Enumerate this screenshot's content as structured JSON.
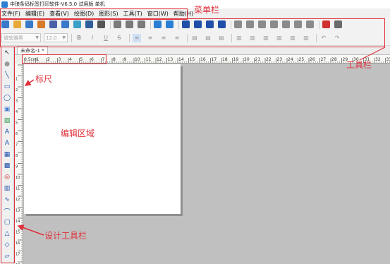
{
  "window": {
    "title": "中琅条码标签打印软件-V6.5.0 试用版 单机"
  },
  "menubar": {
    "items": [
      {
        "label": "文件(F)"
      },
      {
        "label": "编辑(E)"
      },
      {
        "label": "查看(V)"
      },
      {
        "label": "绘图(D)"
      },
      {
        "label": "图形(S)"
      },
      {
        "label": "工具(T)"
      },
      {
        "label": "窗口(W)"
      },
      {
        "label": "帮助(H)"
      }
    ]
  },
  "format_toolbar": {
    "font_placeholder": "微软雅黑",
    "size_placeholder": "12.0",
    "bold": "B",
    "italic": "I",
    "underline": "U",
    "strike": "S"
  },
  "document": {
    "tab_label": "未命名-1 *"
  },
  "ruler": {
    "unit_label": "0.5cm",
    "h_ticks": [
      "1",
      "2",
      "3",
      "4",
      "5",
      "6",
      "7",
      "8",
      "9",
      "10",
      "11",
      "12",
      "13",
      "14",
      "15",
      "16",
      "17",
      "18",
      "19",
      "20",
      "21",
      "22",
      "23",
      "24",
      "25",
      "26",
      "27",
      "28",
      "29",
      "30",
      "31",
      "32",
      "33"
    ]
  },
  "annotations": {
    "menubar": "菜单栏",
    "toolbar": "工具栏",
    "ruler": "标尺",
    "edit_area": "编辑区域",
    "design_toolbar": "设计工具栏"
  },
  "colors": {
    "annotation": "#e0303a",
    "workspace": "#c0c0c0",
    "page": "#ffffff"
  },
  "icons": {
    "toolbar1": [
      "new-icon",
      "open-icon",
      "save-icon",
      "settings-icon",
      "print-icon",
      "print-preview-icon",
      "database-icon",
      "barcode-icon",
      "grid-icon",
      "cut-icon",
      "copy-icon",
      "paste-icon",
      "undo-icon",
      "redo-icon",
      "zoom-in-icon",
      "zoom-out-icon",
      "zoom-fit-icon",
      "zoom-page-icon",
      "align-left-icon",
      "align-center-icon",
      "align-right-icon",
      "align-top-icon",
      "align-middle-icon",
      "align-bottom-icon",
      "distribute-icon",
      "pdf-icon",
      "calculator-icon"
    ],
    "design_tools": [
      "select-icon",
      "pan-icon",
      "line-icon",
      "rectangle-icon",
      "ellipse-icon",
      "image-icon",
      "landscape-icon",
      "text-icon",
      "rich-text-icon",
      "barcode-tool-icon",
      "qrcode-icon",
      "stamp-icon",
      "table-icon",
      "curve-icon",
      "arc-icon",
      "rounded-rect-icon",
      "triangle-icon",
      "diamond-icon",
      "parallelogram-icon"
    ]
  }
}
